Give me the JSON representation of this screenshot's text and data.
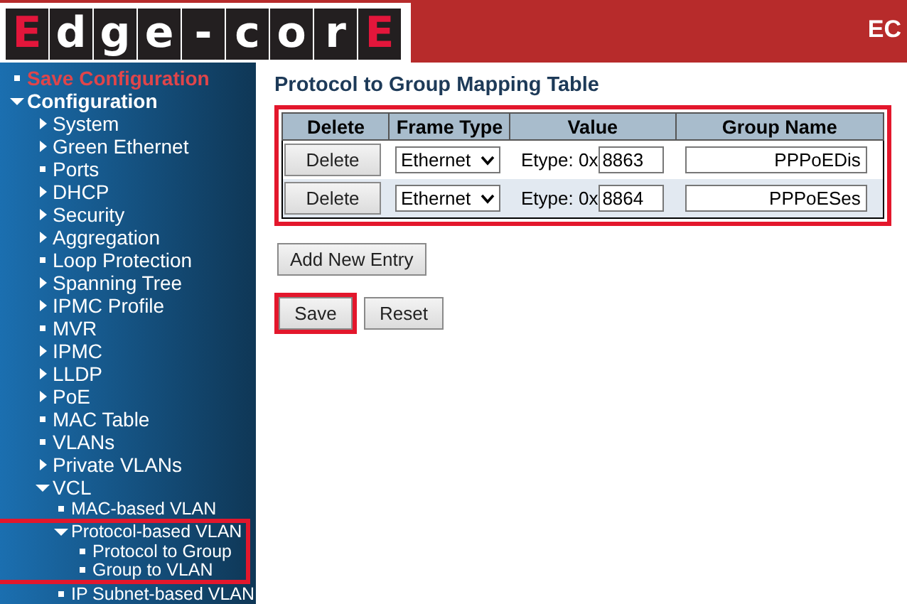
{
  "header": {
    "logo": [
      {
        "letter": "E",
        "kind": "accent"
      },
      {
        "letter": "d",
        "kind": "plain"
      },
      {
        "letter": "g",
        "kind": "plain"
      },
      {
        "letter": "e",
        "kind": "plain"
      },
      {
        "letter": "-",
        "kind": "plain"
      },
      {
        "letter": "c",
        "kind": "plain"
      },
      {
        "letter": "o",
        "kind": "plain"
      },
      {
        "letter": "r",
        "kind": "plain"
      },
      {
        "letter": "E",
        "kind": "accent"
      }
    ],
    "title": "EC"
  },
  "sidebar": {
    "items": [
      {
        "label": "Save Configuration",
        "kind": "action",
        "highlighted": false
      },
      {
        "label": "Configuration",
        "kind": "folder",
        "expanded": true,
        "highlighted": false,
        "children": [
          {
            "label": "System",
            "kind": "folder",
            "expanded": false,
            "highlighted": false
          },
          {
            "label": "Green Ethernet",
            "kind": "folder",
            "expanded": false,
            "highlighted": false
          },
          {
            "label": "Ports",
            "kind": "page",
            "highlighted": false
          },
          {
            "label": "DHCP",
            "kind": "folder",
            "expanded": false,
            "highlighted": false
          },
          {
            "label": "Security",
            "kind": "folder",
            "expanded": false,
            "highlighted": false
          },
          {
            "label": "Aggregation",
            "kind": "folder",
            "expanded": false,
            "highlighted": false
          },
          {
            "label": "Loop Protection",
            "kind": "page",
            "highlighted": false
          },
          {
            "label": "Spanning Tree",
            "kind": "folder",
            "expanded": false,
            "highlighted": false
          },
          {
            "label": "IPMC Profile",
            "kind": "folder",
            "expanded": false,
            "highlighted": false
          },
          {
            "label": "MVR",
            "kind": "page",
            "highlighted": false
          },
          {
            "label": "IPMC",
            "kind": "folder",
            "expanded": false,
            "highlighted": false
          },
          {
            "label": "LLDP",
            "kind": "folder",
            "expanded": false,
            "highlighted": false
          },
          {
            "label": "PoE",
            "kind": "folder",
            "expanded": false,
            "highlighted": false
          },
          {
            "label": "MAC Table",
            "kind": "page",
            "highlighted": false
          },
          {
            "label": "VLANs",
            "kind": "page",
            "highlighted": false
          },
          {
            "label": "Private VLANs",
            "kind": "folder",
            "expanded": false,
            "highlighted": false
          },
          {
            "label": "VCL",
            "kind": "folder",
            "expanded": true,
            "highlighted": false,
            "children": [
              {
                "label": "MAC-based VLAN",
                "kind": "page",
                "highlighted": false
              },
              {
                "label": "Protocol-based VLAN",
                "kind": "folder",
                "expanded": true,
                "highlighted": true,
                "children": [
                  {
                    "label": "Protocol to Group",
                    "kind": "page",
                    "highlighted": false
                  },
                  {
                    "label": "Group to VLAN",
                    "kind": "page",
                    "highlighted": false
                  }
                ]
              },
              {
                "label": "IP Subnet-based VLAN",
                "kind": "page",
                "highlighted": false
              }
            ]
          }
        ]
      }
    ]
  },
  "main": {
    "title": "Protocol to Group Mapping Table",
    "table": {
      "highlighted": true,
      "columns": [
        "Delete",
        "Frame Type",
        "Value",
        "Group Name"
      ],
      "rows": [
        {
          "delete": "Delete",
          "frame_type": "Ethernet",
          "value_prefix": "Etype: 0x",
          "value": "8863",
          "group_name": "PPPoEDis"
        },
        {
          "delete": "Delete",
          "frame_type": "Ethernet",
          "value_prefix": "Etype: 0x",
          "value": "8864",
          "group_name": "PPPoESes"
        }
      ]
    },
    "add_button": {
      "label": "Add New Entry",
      "highlighted": false
    },
    "buttons": [
      {
        "label": "Save",
        "highlighted": true
      },
      {
        "label": "Reset",
        "highlighted": false
      }
    ]
  }
}
